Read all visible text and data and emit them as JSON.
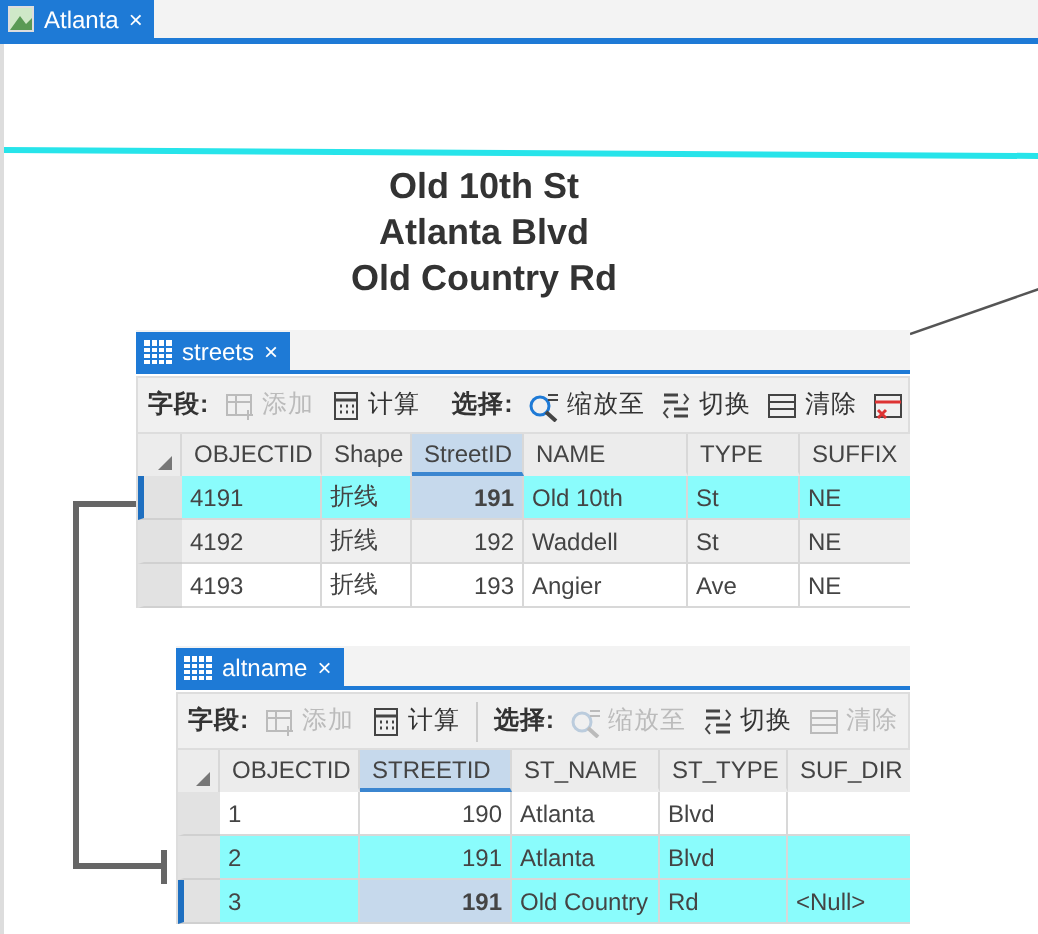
{
  "map": {
    "tab": {
      "title": "Atlanta",
      "close": "×",
      "selected": true
    },
    "labels": [
      "Old 10th St",
      "Atlanta Blvd",
      "Old Country Rd"
    ]
  },
  "tables": [
    {
      "tab": {
        "title": "streets",
        "close": "×",
        "selected": true
      },
      "toolbar": {
        "field_label": "字段:",
        "field_tools": [
          {
            "kind": "add",
            "label": "添加",
            "disabled": true
          },
          {
            "kind": "calculate",
            "label": "计算",
            "disabled": false
          }
        ],
        "select_label": "选择:",
        "select_tools": [
          {
            "kind": "zoom",
            "label": "缩放至",
            "disabled": false
          },
          {
            "kind": "switch",
            "label": "切换",
            "disabled": false
          },
          {
            "kind": "clear",
            "label": "清除",
            "disabled": false
          },
          {
            "kind": "remove",
            "disabled": false
          }
        ]
      },
      "columns": [
        {
          "label": "OBJECTID",
          "numeric": false,
          "selected": false
        },
        {
          "label": "Shape",
          "numeric": false,
          "selected": false
        },
        {
          "label": "StreetID",
          "numeric": true,
          "selected": true
        },
        {
          "label": "NAME",
          "numeric": false,
          "selected": false
        },
        {
          "label": "TYPE",
          "numeric": false,
          "selected": false
        },
        {
          "label": "SUFFIX",
          "numeric": false,
          "selected": false
        }
      ],
      "rows": [
        {
          "cells": [
            "4191",
            "折线",
            "191",
            "Old 10th",
            "St",
            "NE"
          ],
          "selected": true,
          "current": true,
          "shaded": false
        },
        {
          "cells": [
            "4192",
            "折线",
            "192",
            "Waddell",
            "St",
            "NE"
          ],
          "selected": false,
          "current": false,
          "shaded": true
        },
        {
          "cells": [
            "4193",
            "折线",
            "193",
            "Angier",
            "Ave",
            "NE"
          ],
          "selected": false,
          "current": false,
          "shaded": false
        }
      ]
    },
    {
      "tab": {
        "title": "altname",
        "close": "×",
        "selected": true
      },
      "toolbar": {
        "field_label": "字段:",
        "field_tools": [
          {
            "kind": "add",
            "label": "添加",
            "disabled": true
          },
          {
            "kind": "calculate",
            "label": "计算",
            "disabled": false
          }
        ],
        "select_label": "选择:",
        "select_tools": [
          {
            "kind": "zoom",
            "label": "缩放至",
            "disabled": true
          },
          {
            "kind": "switch",
            "label": "切换",
            "disabled": false
          },
          {
            "kind": "clear",
            "label": "清除",
            "disabled": true
          }
        ]
      },
      "columns": [
        {
          "label": "OBJECTID",
          "numeric": false,
          "selected": false
        },
        {
          "label": "STREETID",
          "numeric": true,
          "selected": true
        },
        {
          "label": "ST_NAME",
          "numeric": false,
          "selected": false
        },
        {
          "label": "ST_TYPE",
          "numeric": false,
          "selected": false
        },
        {
          "label": "SUF_DIR",
          "numeric": false,
          "selected": false
        }
      ],
      "rows": [
        {
          "cells": [
            "1",
            "190",
            "Atlanta",
            "Blvd",
            ""
          ],
          "selected": false,
          "current": false,
          "shaded": false
        },
        {
          "cells": [
            "2",
            "191",
            "Atlanta",
            "Blvd",
            ""
          ],
          "selected": true,
          "current": false,
          "shaded": false
        },
        {
          "cells": [
            "3",
            "191",
            "Old Country",
            "Rd",
            "<Null>"
          ],
          "selected": true,
          "current": true,
          "shaded": false
        }
      ]
    }
  ]
}
